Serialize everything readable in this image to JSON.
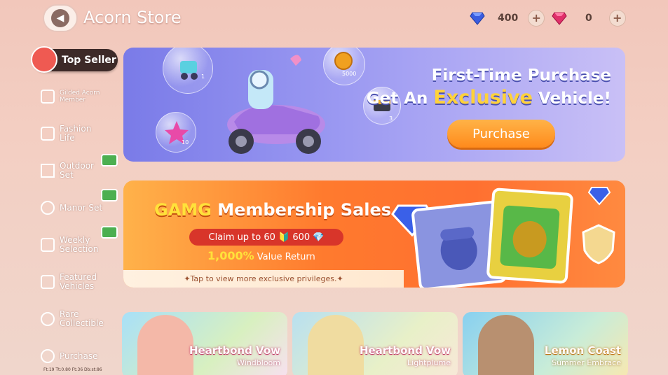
{
  "header": {
    "title": "Acorn Store",
    "back_icon": "chevron-left-icon",
    "currencies": [
      {
        "icon": "blue-gem-icon",
        "color": "#3a5ce0",
        "value": "400"
      },
      {
        "icon": "pink-gem-icon",
        "color": "#e0306a",
        "value": "0"
      }
    ],
    "plus_label": "+"
  },
  "sidebar": {
    "items": [
      {
        "label": "Top Seller",
        "icon": "fire-icon",
        "active": true
      },
      {
        "label": "Gilded Acorn Member",
        "icon": "acorn-card-icon"
      },
      {
        "label": "Fashion Life",
        "icon": "wardrobe-icon"
      },
      {
        "label": "Outdoor Set",
        "icon": "tent-icon",
        "gift": true
      },
      {
        "label": "Manor Set",
        "icon": "manor-icon",
        "gift": true
      },
      {
        "label": "Weekly Selection",
        "icon": "thumbs-up-icon",
        "gift": true
      },
      {
        "label": "Featured Vehicles",
        "icon": "car-icon"
      },
      {
        "label": "Rare Collectible",
        "icon": "collectible-icon"
      },
      {
        "label": "Purchase",
        "icon": "purchase-icon"
      }
    ]
  },
  "banner_vehicle": {
    "line1": "First-Time Purchase",
    "line2_prefix": "Get An ",
    "line2_highlight": "Exclusive",
    "line2_suffix": " Vehicle!",
    "button": "Purchase",
    "bubbles": [
      {
        "label": "1"
      },
      {
        "label": "5000"
      },
      {
        "label": "10"
      },
      {
        "label": "3"
      }
    ]
  },
  "banner_membership": {
    "title_prefix": "GAMG",
    "title_rest": " Membership Sales",
    "claim": "Claim up to 60 🔰 600 💎",
    "return_pct": "1,000%",
    "return_label": " Value Return",
    "tap_hint": "✦Tap to view more exclusive privileges.✦"
  },
  "shop_cards": [
    {
      "name": "Heartbond Vow",
      "subtitle": "Windbloom"
    },
    {
      "name": "Heartbond Vow",
      "subtitle": "Lightplume"
    },
    {
      "name": "Lemon Coast",
      "subtitle": "Summer Embrace"
    }
  ],
  "debug_line": "Ft:19   Tt:0.80   Ft:36   Db:st:86"
}
